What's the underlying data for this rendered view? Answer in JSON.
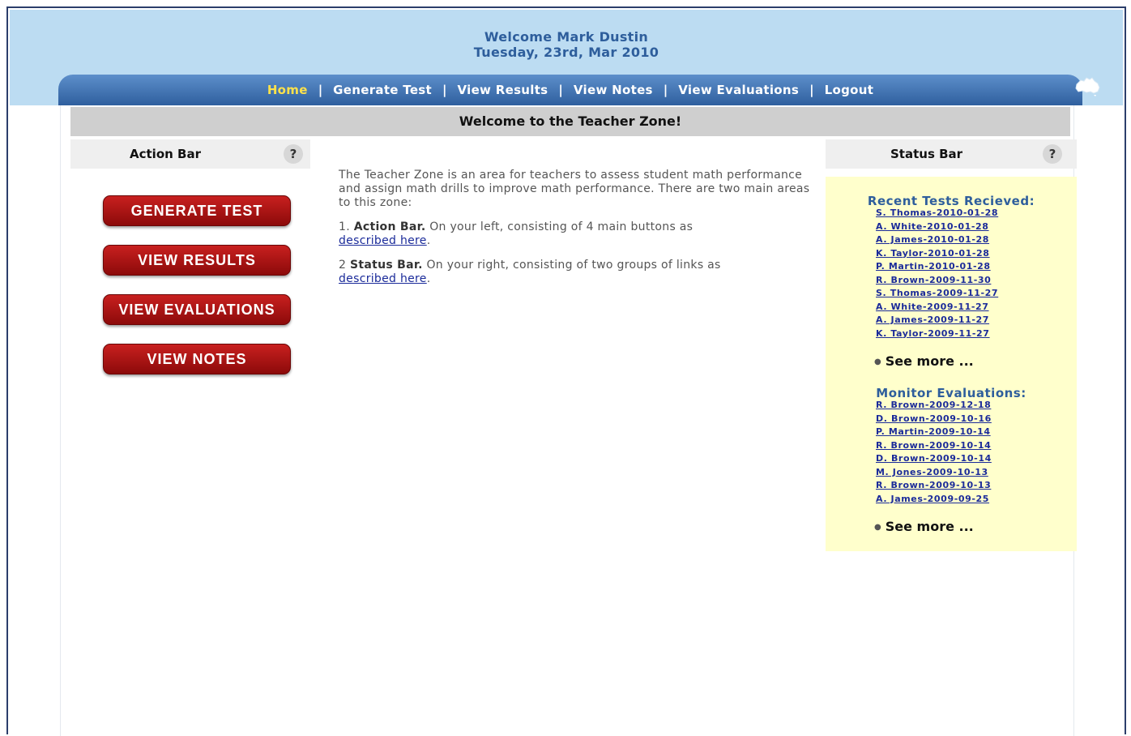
{
  "header": {
    "welcome_line": "Welcome Mark Dustin",
    "date_line": "Tuesday, 23rd, Mar 2010"
  },
  "nav": {
    "items": [
      "Home",
      "Generate Test",
      "View Results",
      "View Notes",
      "View Evaluations",
      "Logout"
    ],
    "active": "Home",
    "separator": "|"
  },
  "page_title": "Welcome to the Teacher Zone!",
  "action_bar": {
    "title": "Action Bar",
    "help": "?",
    "buttons": [
      "GENERATE TEST",
      "VIEW RESULTS",
      "VIEW EVALUATIONS",
      "VIEW NOTES"
    ]
  },
  "intro": {
    "paragraph": "The Teacher Zone is an area for teachers to assess student math performance and assign math drills to improve math performance. There are two main areas to this zone:",
    "item1_prefix": "1. ",
    "item1_bold": "Action Bar.",
    "item1_text": " On your left, consisting of 4 main buttons as",
    "item1_link": "described here",
    "item2_prefix": "2 ",
    "item2_bold": "Status Bar.",
    "item2_text": " On your right, consisting of two groups of links as",
    "item2_link": "described here",
    "period": "."
  },
  "status_bar": {
    "title": "Status Bar",
    "help": "?",
    "recent_title": "Recent Tests Recieved:",
    "recent_tests": [
      "S. Thomas-2010-01-28",
      "A. White-2010-01-28",
      "A. James-2010-01-28",
      "K. Taylor-2010-01-28",
      "P. Martin-2010-01-28",
      "R. Brown-2009-11-30",
      "S. Thomas-2009-11-27",
      "A. White-2009-11-27",
      "A. James-2009-11-27",
      "K. Taylor-2009-11-27"
    ],
    "see_more": "See more ...",
    "monitor_title": "Monitor Evaluations:",
    "monitor_evals": [
      "R. Brown-2009-12-18",
      "D. Brown-2009-10-16",
      "P. Martin-2009-10-14",
      "R. Brown-2009-10-14",
      "D. Brown-2009-10-14",
      "M. Jones-2009-10-13",
      "R. Brown-2009-10-13",
      "A. James-2009-09-25"
    ]
  },
  "colors": {
    "header_band": "#bcdcf2",
    "nav_bar": "#3f6fae",
    "nav_active": "#ffe24a",
    "action_button": "#b01515",
    "status_panel": "#ffffcc",
    "link": "#1b2b9a"
  },
  "icons": {
    "corner_logo": "australia-map-icon"
  }
}
